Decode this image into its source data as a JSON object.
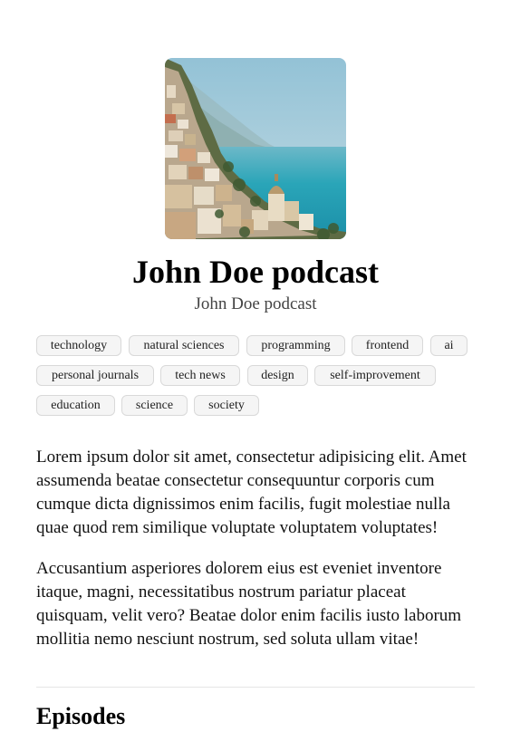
{
  "podcast": {
    "title": "John Doe podcast",
    "author": "John Doe podcast",
    "cover_alt": "podcast cover image of coastal cliff village"
  },
  "tags": [
    [
      "technology",
      "natural sciences",
      "programming",
      "frontend",
      "ai"
    ],
    [
      "personal journals",
      "tech news",
      "design",
      "self-improvement"
    ],
    [
      "education",
      "science",
      "society"
    ]
  ],
  "description": {
    "paragraph_1": "Lorem ipsum dolor sit amet, consectetur adipisicing elit. Amet assumenda beatae consectetur consequuntur corporis cum cumque dicta dignissimos enim facilis, fugit molestiae nulla quae quod rem similique voluptate voluptatem voluptates!",
    "paragraph_2": "Accusantium asperiores dolorem eius est eveniet inventore itaque, magni, necessitatibus nostrum pariatur placeat quisquam, velit vero? Beatae dolor enim facilis iusto laborum mollitia nemo nesciunt nostrum, sed soluta ullam vitae!"
  },
  "episodes": {
    "heading": "Episodes"
  },
  "colors": {
    "tag_background": "#f5f5f5",
    "tag_border": "#d9d9d9",
    "divider": "#e5e5e5",
    "sea": "#2aa5b8",
    "sky": "#a9cdd9"
  }
}
